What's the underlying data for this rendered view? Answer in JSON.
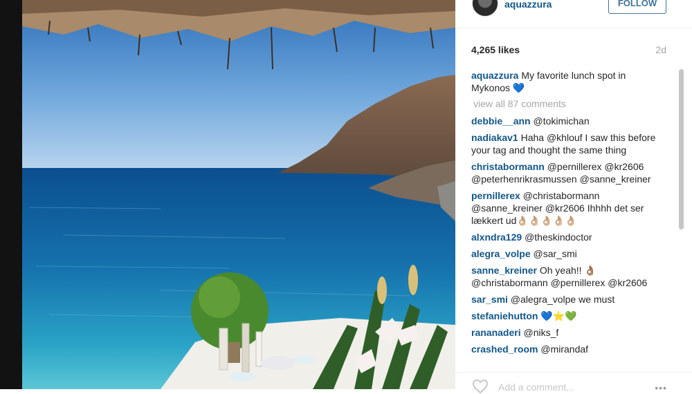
{
  "post": {
    "username": "aquazzura",
    "follow_label": "FOLLOW",
    "likes": "4,265 likes",
    "age": "2d",
    "caption_user": "aquazzura",
    "caption_text": "My favorite lunch spot in Mykonos 💙",
    "view_all": "view all 87 comments",
    "add_comment_placeholder": "Add a comment...",
    "more": "•••"
  },
  "comments": [
    {
      "user": "debbie__ann",
      "text": "@tokimichan"
    },
    {
      "user": "nadiakav1",
      "text": "Haha @khlouf I saw this before your tag and thought the same thing"
    },
    {
      "user": "christabormann",
      "text": "@pernillerex @kr2606 @peterhenrikrasmussen @sanne_kreiner"
    },
    {
      "user": "pernillerex",
      "text": "@christabormann @sanne_kreiner @kr2606 Ihhhh det ser lækkert ud👌🏼👌🏼👌🏼👌🏼👌🏼"
    },
    {
      "user": "alxndra129",
      "text": "@theskindoctor"
    },
    {
      "user": "alegra_volpe",
      "text": "@sar_smi"
    },
    {
      "user": "sanne_kreiner",
      "text": "Oh yeah!! 👌🏽 @christabormann @pernillerex @kr2606"
    },
    {
      "user": "sar_smi",
      "text": "@alegra_volpe we must"
    },
    {
      "user": "stefaniehutton",
      "text": "💙⭐💚"
    },
    {
      "user": "rananaderi",
      "text": "@niks_f"
    },
    {
      "user": "crashed_room",
      "text": "@mirandaf"
    }
  ],
  "icons": {
    "heart": "heart-outline-icon",
    "more": "more-horizontal-icon"
  },
  "colors": {
    "link": "#125688",
    "follow": "#3f729b",
    "muted": "#a5a7aa"
  }
}
